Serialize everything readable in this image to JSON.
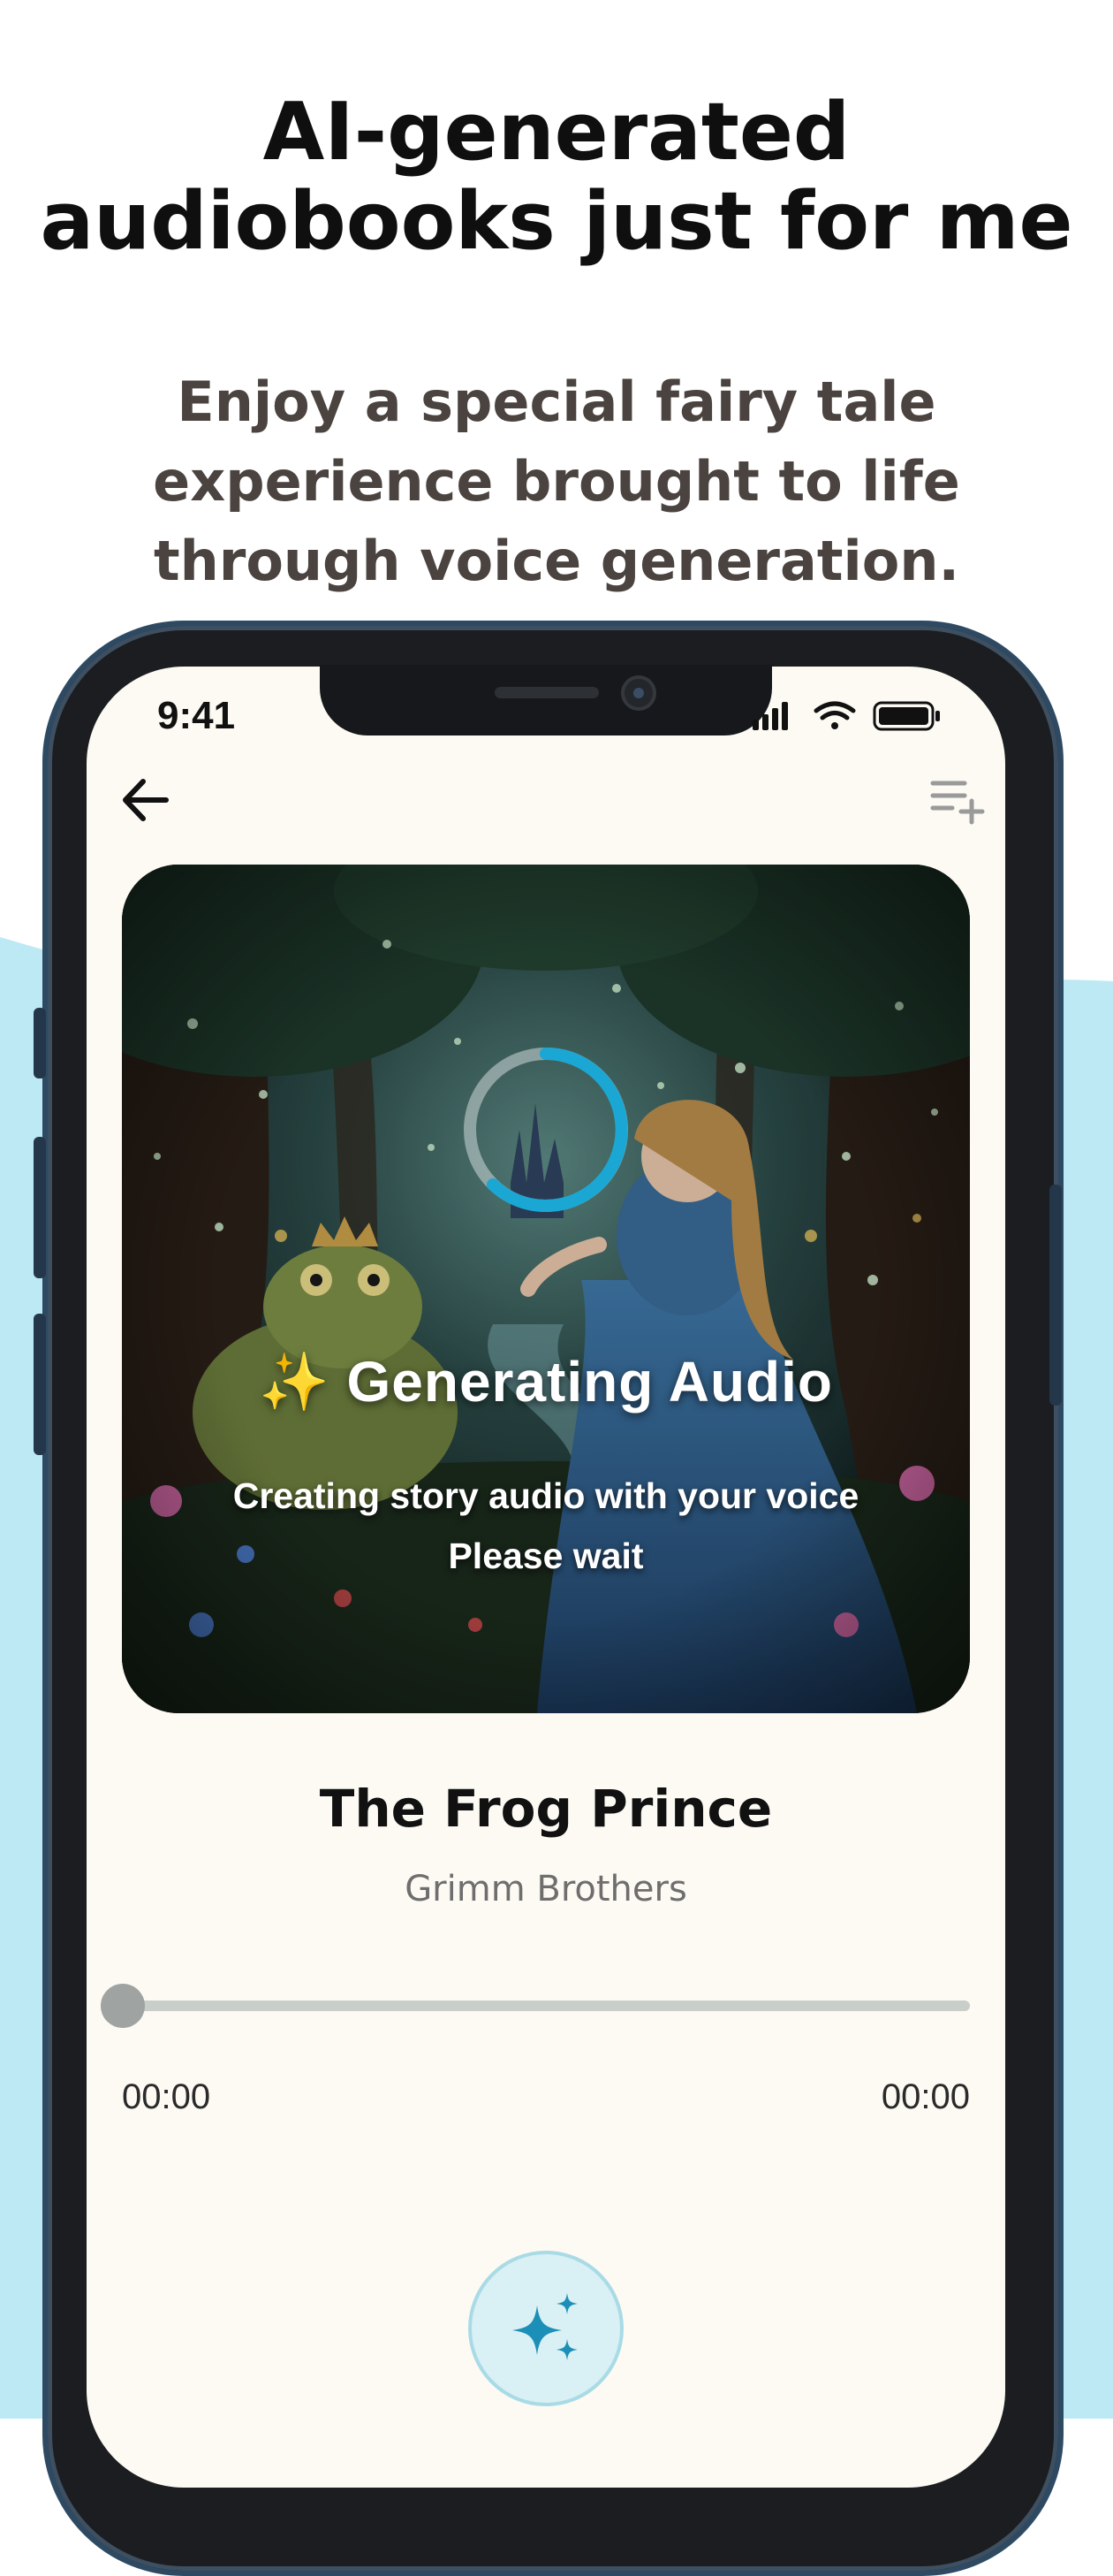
{
  "promo": {
    "headline_line1": "AI-generated",
    "headline_line2": "audiobooks just for me",
    "subhead_line1": "Enjoy a special fairy tale",
    "subhead_line2": "experience brought to life",
    "subhead_line3": "through voice generation.",
    "background_accent": "#bde9f5"
  },
  "status_bar": {
    "time": "9:41",
    "icons": [
      "cellular-signal-icon",
      "wifi-icon",
      "battery-icon"
    ]
  },
  "nav": {
    "back_icon": "arrow-left-icon",
    "playlist_icon": "playlist-add-icon"
  },
  "cover": {
    "generating_emoji": "✨",
    "generating_title": "Generating Audio",
    "generating_line1": "Creating story audio with your voice",
    "generating_line2": "Please wait",
    "spinner_color": "#1aa7d3"
  },
  "track": {
    "title": "The Frog Prince",
    "author": "Grimm Brothers",
    "progress": 0,
    "elapsed": "00:00",
    "duration": "00:00"
  },
  "ai_button": {
    "icon": "sparkles-icon",
    "color": "#1c8fb8"
  }
}
